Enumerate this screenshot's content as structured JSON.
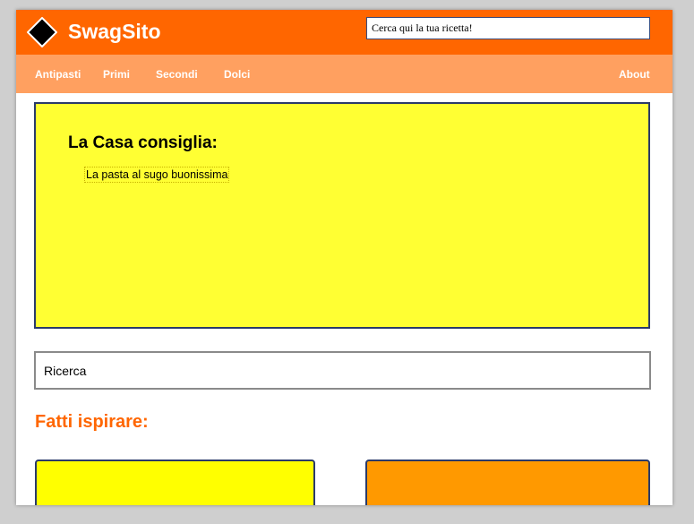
{
  "header": {
    "brand": "SwagSito",
    "logo_icon": "diamond-icon",
    "search_placeholder": "Cerca qui la tua ricetta!"
  },
  "nav": {
    "items": [
      {
        "label": "Antipasti"
      },
      {
        "label": "Primi"
      },
      {
        "label": "Secondi"
      },
      {
        "label": "Dolci"
      }
    ],
    "about_label": "About"
  },
  "featured": {
    "title": "La Casa consiglia:",
    "link": "La pasta al sugo buonissima"
  },
  "search_bar": {
    "placeholder": "Ricerca"
  },
  "inspire": {
    "title": "Fatti ispirare:",
    "cards": [
      {
        "color": "#ffff00"
      },
      {
        "color": "#ff9900"
      }
    ]
  },
  "colors": {
    "header": "#ff6600",
    "nav": "#ffa060",
    "featured_bg": "#ffff33",
    "accent": "#ff6600",
    "border": "#2a3a6a"
  }
}
